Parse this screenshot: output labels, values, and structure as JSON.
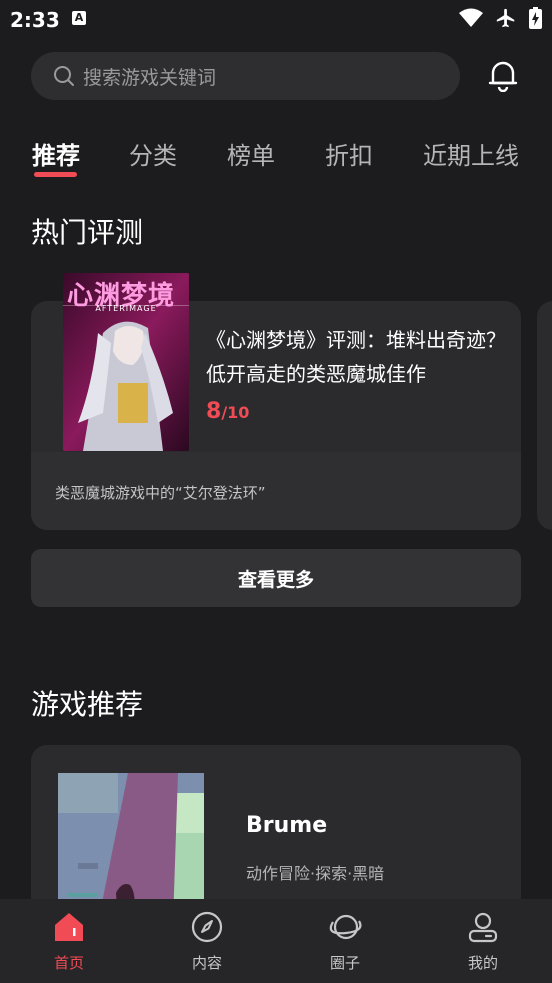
{
  "status_bar": {
    "time": "2:33",
    "badge": "A"
  },
  "search": {
    "placeholder": "搜索游戏关键词"
  },
  "tabs": [
    "推荐",
    "分类",
    "榜单",
    "折扣",
    "近期上线"
  ],
  "hot_reviews": {
    "title": "热门评测",
    "card": {
      "title": "《心渊梦境》评测：堆料出奇迹？低开高走的类恶魔城佳作",
      "score": "8",
      "score_max": "/10",
      "description": "类恶魔城游戏中的“艾尔登法环”",
      "cover_text": "心渊梦境",
      "cover_subtitle": "AFTERIMAGE"
    },
    "more_button": "查看更多"
  },
  "game_recommend": {
    "title": "游戏推荐",
    "card": {
      "name": "Brume",
      "tags": "动作冒险·探索·黑暗"
    }
  },
  "bottom_nav": [
    {
      "label": "首页",
      "icon": "home-icon",
      "active": true
    },
    {
      "label": "内容",
      "icon": "compass-icon",
      "active": false
    },
    {
      "label": "圈子",
      "icon": "planet-icon",
      "active": false
    },
    {
      "label": "我的",
      "icon": "profile-icon",
      "active": false
    }
  ],
  "colors": {
    "accent": "#f14c55",
    "background": "#1c1c1e",
    "card": "#2b2b2d"
  }
}
